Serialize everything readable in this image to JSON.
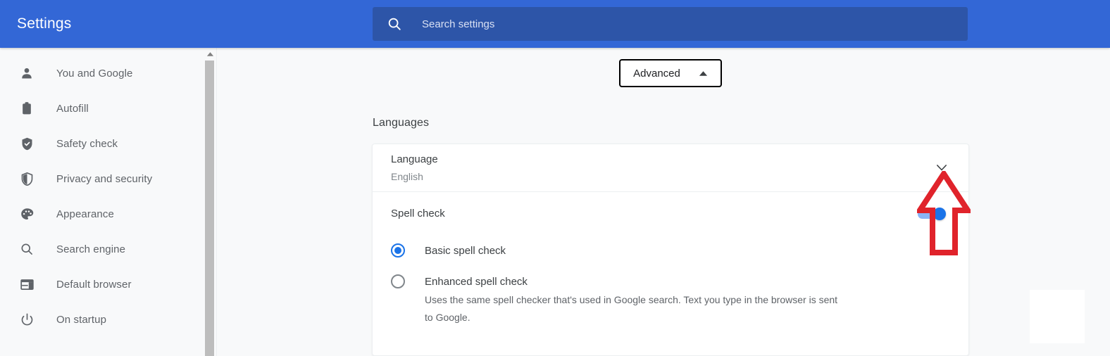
{
  "header": {
    "title": "Settings",
    "search": {
      "placeholder": "Search settings",
      "value": "",
      "icon": "search-icon"
    },
    "background_color": "#3367d6",
    "search_background_color": "#2d55a8"
  },
  "sidebar": {
    "items": [
      {
        "label": "You and Google",
        "icon": "person-icon"
      },
      {
        "label": "Autofill",
        "icon": "clipboard-icon"
      },
      {
        "label": "Safety check",
        "icon": "shield-check-icon"
      },
      {
        "label": "Privacy and security",
        "icon": "shield-half-icon"
      },
      {
        "label": "Appearance",
        "icon": "palette-icon"
      },
      {
        "label": "Search engine",
        "icon": "search-icon"
      },
      {
        "label": "Default browser",
        "icon": "browser-window-icon"
      },
      {
        "label": "On startup",
        "icon": "power-icon"
      }
    ],
    "scrollbar": {
      "up_arrow_icon": "caret-up-icon"
    }
  },
  "main": {
    "advanced_button": {
      "label": "Advanced",
      "caret_icon": "caret-up-icon",
      "expanded": true
    },
    "section_title": "Languages",
    "language_row": {
      "title": "Language",
      "value": "English",
      "expand_icon": "chevron-down-icon"
    },
    "spell_check_row": {
      "label": "Spell check",
      "toggle_state": "on",
      "toggle_color": "#1a73e8"
    },
    "spell_check_options": [
      {
        "label": "Basic spell check",
        "selected": true,
        "description": ""
      },
      {
        "label": "Enhanced spell check",
        "selected": false,
        "description": "Uses the same spell checker that's used in Google search. Text you type in the browser is sent to Google."
      }
    ]
  },
  "annotation": {
    "type": "arrow-up",
    "color": "#e0232b",
    "points_to": "chevron-down-icon"
  }
}
